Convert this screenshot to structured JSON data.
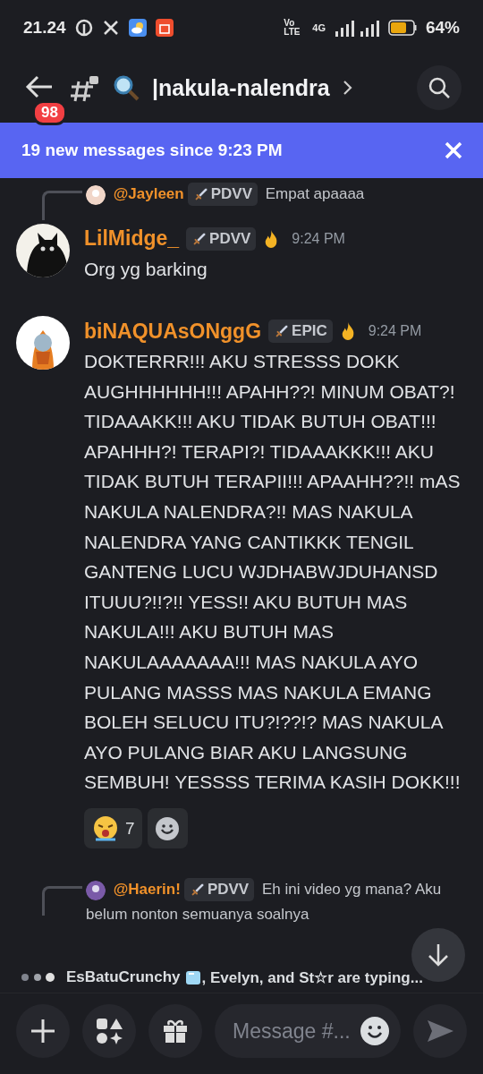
{
  "status_bar": {
    "time": "21.24",
    "network": "Vo LTE",
    "network_type": "4G",
    "battery": "64%"
  },
  "header": {
    "unread_badge": "98",
    "channel": "|nakula-nalendra"
  },
  "banner": {
    "text": "19 new messages since 9:23 PM"
  },
  "messages": [
    {
      "kind": "reply_preview",
      "author": "@Jayleen",
      "tag": "PDVV",
      "text": "Empat apaaaa"
    },
    {
      "kind": "message",
      "author": "LilMidge_",
      "tag": "PDVV",
      "time": "9:24 PM",
      "text": "Org yg barking"
    },
    {
      "kind": "message",
      "author": "biNAQUAsONggG",
      "tag": "EPIC",
      "time": "9:24 PM",
      "text": "DOKTERRR!!! AKU STRESSS DOKK AUGHHHHHH!!! APAHH??! MINUM OBAT?! TIDAAAKK!!! AKU TIDAK BUTUH OBAT!!! APAHHH?! TERAPI?! TIDAAAKKK!!! AKU TIDAK BUTUH TERAPII!!! APAAHH??!! mAS NAKULA NALENDRA?!! MAS NAKULA NALENDRA YANG CANTIKKK TENGIL GANTENG LUCU WJDHABWJDUHANSD ITUUU?!!?!! YESS!! AKU BUTUH MAS NAKULA!!! AKU BUTUH MAS NAKULAAAAAAA!!! MAS NAKULA AYO PULANG MASSS MAS NAKULA EMANG BOLEH SELUCU ITU?!??!? MAS NAKULA AYO PULANG BIAR AKU LANGSUNG SEMBUH! YESSSS TERIMA KASIH DOKK!!!",
      "reactions": [
        {
          "count": "7"
        }
      ]
    },
    {
      "kind": "reply_preview",
      "author": "@Haerin!",
      "tag": "PDVV",
      "text": "Eh ini video yg mana? Aku",
      "text_continued": "belum nonton semuanya soalnya"
    }
  ],
  "typing": {
    "first": "EsBatuCrunchy",
    "rest": ", Evelyn, and St☆r are typing..."
  },
  "composer": {
    "placeholder": "Message #..."
  }
}
